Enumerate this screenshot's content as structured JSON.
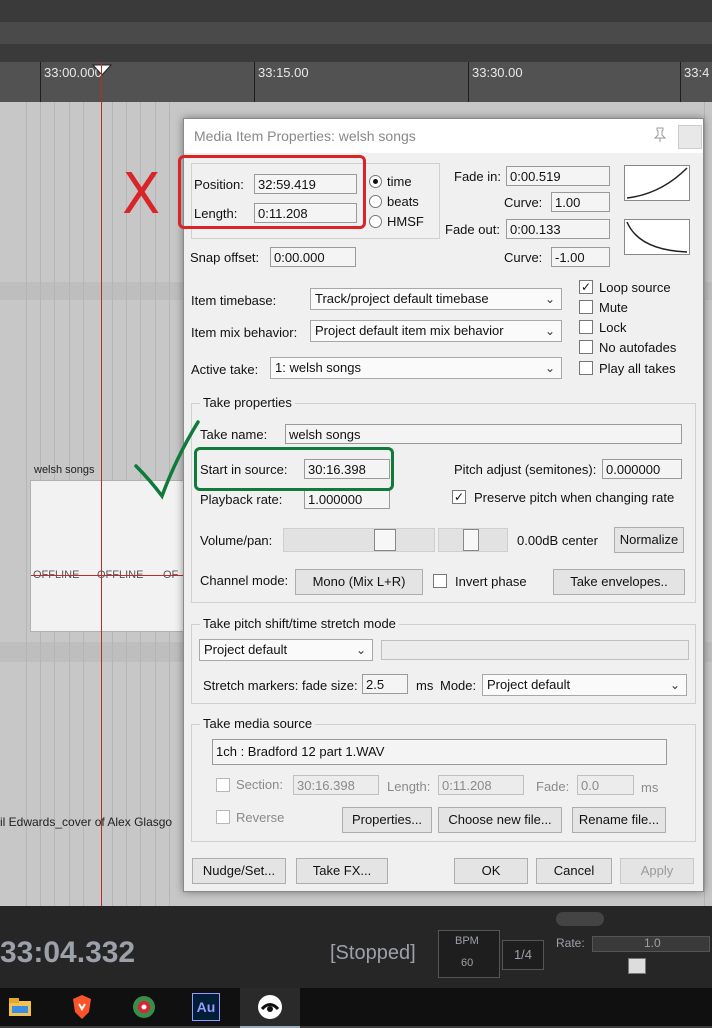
{
  "timeline": {
    "markers": [
      "33:00.000",
      "33:15.00",
      "33:30.00",
      "33:4"
    ],
    "track_item_title": "welsh songs",
    "offline_labels": [
      "OFFLINE",
      "OFFLINE",
      "OF"
    ],
    "bottom_caption": "il Edwards_cover of Alex Glasgo"
  },
  "transport": {
    "time": "33:04.332",
    "status": "[Stopped]",
    "bpm_label": "BPM",
    "bpm_value": "60",
    "time_signature": "1/4",
    "rate_label": "Rate:",
    "rate_value": "1.0"
  },
  "taskbar": {
    "icons": [
      "file-explorer-icon",
      "brave-browser-icon",
      "reaper-icon",
      "audition-icon",
      "game-controller-icon"
    ],
    "audition_text": "Au"
  },
  "dialog": {
    "title": "Media Item Properties:  welsh songs",
    "position_label": "Position:",
    "position_value": "32:59.419",
    "length_label": "Length:",
    "length_value": "0:11.208",
    "time_mode_options": [
      "time",
      "beats",
      "HMSF"
    ],
    "time_mode_selected": "time",
    "snap_offset_label": "Snap offset:",
    "snap_offset_value": "0:00.000",
    "fade_in_label": "Fade in:",
    "fade_in_value": "0:00.519",
    "fade_in_curve_label": "Curve:",
    "fade_in_curve_value": "1.00",
    "fade_out_label": "Fade out:",
    "fade_out_value": "0:00.133",
    "fade_out_curve_label": "Curve:",
    "fade_out_curve_value": "-1.00",
    "item_timebase_label": "Item timebase:",
    "item_timebase_value": "Track/project default timebase",
    "item_mix_label": "Item mix behavior:",
    "item_mix_value": "Project default item mix behavior",
    "active_take_label": "Active take:",
    "active_take_value": "1: welsh songs",
    "checkboxes": {
      "loop_source": {
        "label": "Loop source",
        "checked": true
      },
      "mute": {
        "label": "Mute",
        "checked": false
      },
      "lock": {
        "label": "Lock",
        "checked": false
      },
      "no_autofades": {
        "label": "No autofades",
        "checked": false
      },
      "play_all_takes": {
        "label": "Play all takes",
        "checked": false
      }
    },
    "take_properties": {
      "group_title": "Take properties",
      "take_name_label": "Take name:",
      "take_name_value": "welsh songs",
      "start_in_source_label": "Start in source:",
      "start_in_source_value": "30:16.398",
      "pitch_adjust_label": "Pitch adjust (semitones):",
      "pitch_adjust_value": "0.000000",
      "playback_rate_label": "Playback rate:",
      "playback_rate_value": "1.000000",
      "preserve_pitch_label": "Preserve pitch when changing rate",
      "preserve_pitch_checked": true,
      "volume_pan_label": "Volume/pan:",
      "volume_pan_readout": "0.00dB  center",
      "normalize_label": "Normalize",
      "channel_mode_label": "Channel mode:",
      "channel_mode_value": "Mono (Mix L+R)",
      "invert_phase_label": "Invert phase",
      "take_envelopes_label": "Take envelopes.."
    },
    "pitch_shift": {
      "group_title": "Take pitch shift/time stretch mode",
      "mode_value": "Project default",
      "stretch_fade_label": "Stretch markers: fade size:",
      "stretch_fade_value": "2.5",
      "ms_label": "ms",
      "mode_label": "Mode:",
      "mode2_value": "Project default"
    },
    "media_source": {
      "group_title": "Take media source",
      "source_value": "1ch  : Bradford 12 part 1.WAV",
      "section_label": "Section:",
      "section_value": "30:16.398",
      "length_label": "Length:",
      "length_value": "0:11.208",
      "fade_label": "Fade:",
      "fade_value": "0.0",
      "ms_label": "ms",
      "reverse_label": "Reverse",
      "properties_label": "Properties...",
      "choose_new_file_label": "Choose new file...",
      "rename_file_label": "Rename file..."
    },
    "footer": {
      "nudge_label": "Nudge/Set...",
      "take_fx_label": "Take FX...",
      "ok_label": "OK",
      "cancel_label": "Cancel",
      "apply_label": "Apply"
    }
  },
  "annotations": {
    "red_mark": "X",
    "red_color": "#d8252a",
    "green_color": "#0f7a3a"
  }
}
